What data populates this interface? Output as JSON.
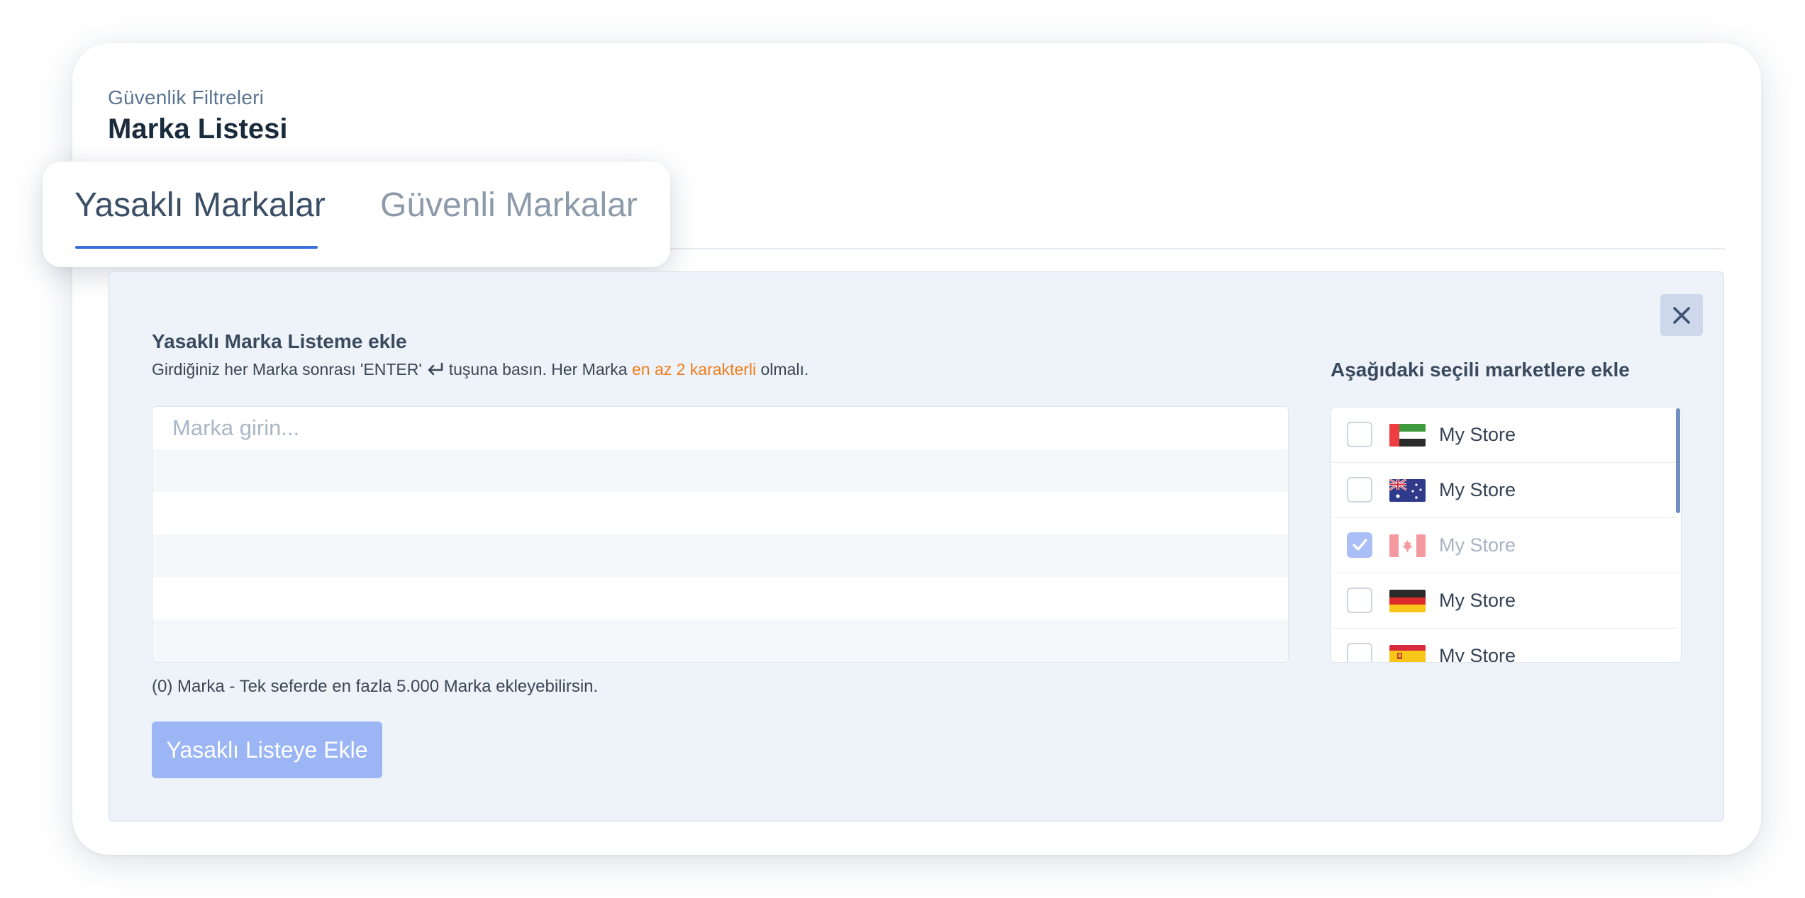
{
  "breadcrumb": "Güvenlik Filtreleri",
  "page_title": "Marka Listesi",
  "tabs": [
    {
      "label": "Yasaklı Markalar",
      "active": true
    },
    {
      "label": "Güvenli Markalar",
      "active": false
    }
  ],
  "form": {
    "title": "Yasaklı Marka Listeme ekle",
    "instruction_before": "Girdiğiniz her Marka sonrası 'ENTER'",
    "instruction_middle": "tuşuna basın. Her Marka",
    "instruction_accent": "en az 2 karakterli",
    "instruction_after": "olmalı.",
    "input_placeholder": "Marka girin...",
    "input_value": "",
    "counter": "(0) Marka - Tek seferde en fazla 5.000 Marka ekleyebilirsin.",
    "submit_label": "Yasaklı Listeye Ekle"
  },
  "stores": {
    "title": "Aşağıdaki seçili marketlere ekle",
    "items": [
      {
        "name": "My Store",
        "flag": "uae-flag-icon",
        "checked": false
      },
      {
        "name": "My Store",
        "flag": "australia-flag-icon",
        "checked": false
      },
      {
        "name": "My Store",
        "flag": "canada-flag-icon",
        "checked": true
      },
      {
        "name": "My Store",
        "flag": "germany-flag-icon",
        "checked": false
      },
      {
        "name": "My Store",
        "flag": "spain-flag-icon",
        "checked": false
      }
    ]
  },
  "icons": {
    "close": "close-icon",
    "enter": "enter-key-icon",
    "checkmark": "check-icon"
  },
  "colors": {
    "accent": "#3b6fe0",
    "warning_text": "#f07d1a",
    "button_disabled": "#9bb5f5",
    "panel_bg": "#eef2f9"
  }
}
